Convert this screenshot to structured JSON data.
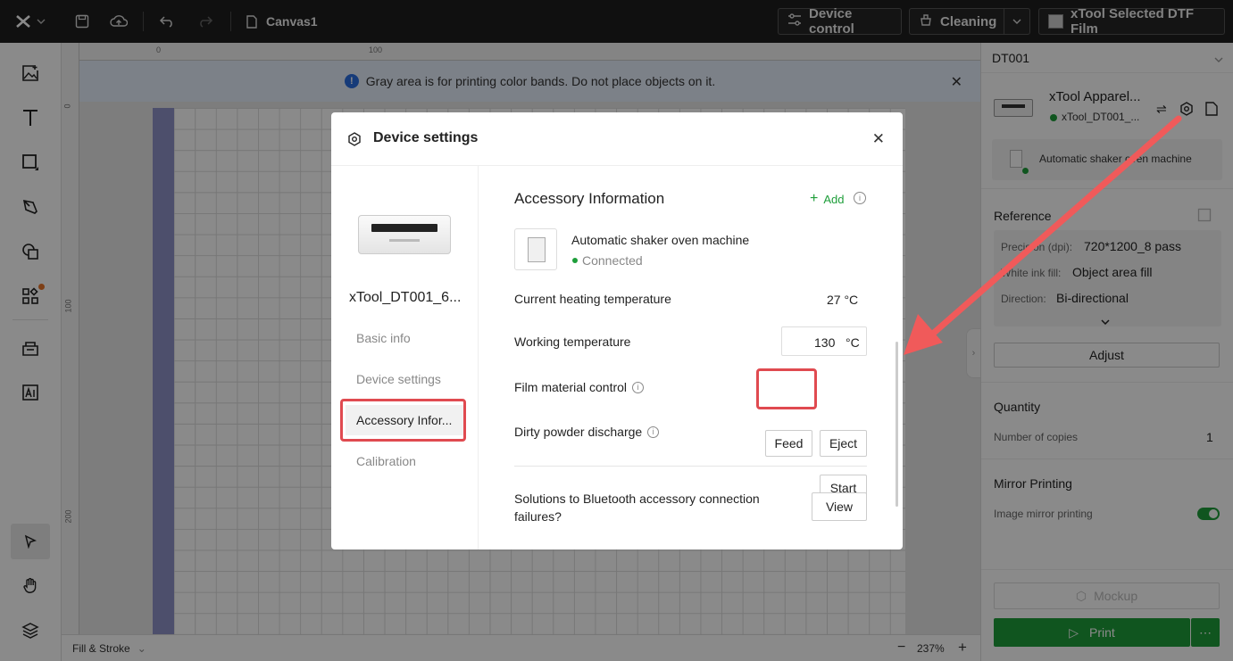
{
  "topbar": {
    "canvas_name": "Canvas1",
    "device_control": "Device control",
    "cleaning": "Cleaning",
    "film": "xTool Selected DTF Film"
  },
  "canvas": {
    "notice": "Gray area is for printing color bands. Do not place objects on it.",
    "ruler_top": [
      "0",
      "100"
    ],
    "ruler_left": [
      "0",
      "100",
      "200"
    ],
    "fill_stroke": "Fill & Stroke",
    "zoom": "237%"
  },
  "right_panel": {
    "device_select": "DT001",
    "device_name": "xTool Apparel...",
    "device_sub": "xTool_DT001_...",
    "accessory": "Automatic shaker oven machine",
    "reference_title": "Reference",
    "precision_label": "Precision (dpi):",
    "precision_value": "720*1200_8 pass",
    "white_label": "White ink fill:",
    "white_value": "Object area fill",
    "direction_label": "Direction:",
    "direction_value": "Bi-directional",
    "adjust": "Adjust",
    "quantity_title": "Quantity",
    "copies_label": "Number of copies",
    "copies_value": "1",
    "mirror_title": "Mirror Printing",
    "mirror_label": "Image mirror printing",
    "mockup": "Mockup",
    "print": "Print"
  },
  "modal": {
    "title": "Device settings",
    "device_name": "xTool_DT001_6...",
    "nav": [
      "Basic info",
      "Device settings",
      "Accessory Infor...",
      "Calibration"
    ],
    "section_title": "Accessory Information",
    "add": "Add",
    "accessory_name": "Automatic shaker oven machine",
    "accessory_status": "Connected",
    "heating_label": "Current heating temperature",
    "heating_value": "27 °C",
    "working_label": "Working temperature",
    "working_value": "130",
    "working_unit": "°C",
    "film_label": "Film material control",
    "feed": "Feed",
    "eject": "Eject",
    "dirty_label": "Dirty powder discharge",
    "start": "Start",
    "solutions_label": "Solutions to Bluetooth accessory connection failures?",
    "view": "View"
  },
  "colors": {
    "accent_green": "#1e9e3a",
    "highlight_red": "#e04a50",
    "arrow": "#f05a5a"
  }
}
